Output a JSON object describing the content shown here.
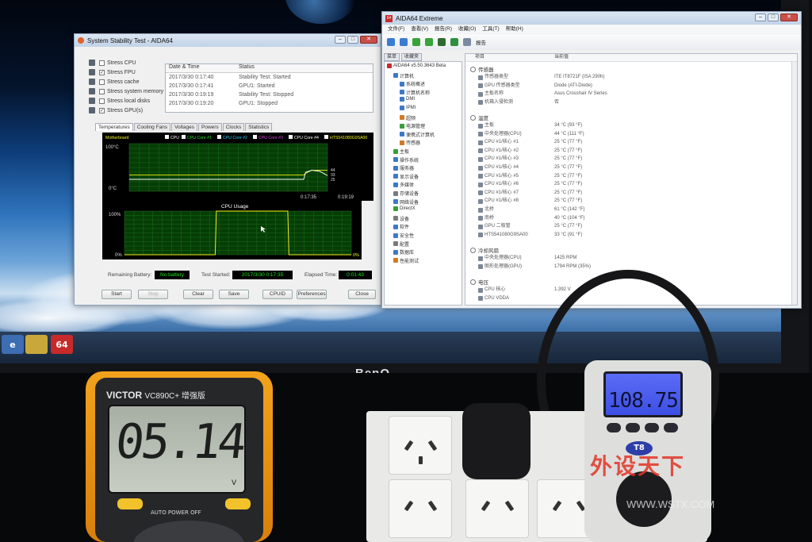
{
  "stability": {
    "title": "System Stability Test - AIDA64",
    "stress_items": [
      {
        "label": "Stress CPU",
        "checked": false
      },
      {
        "label": "Stress FPU",
        "checked": true
      },
      {
        "label": "Stress cache",
        "checked": false
      },
      {
        "label": "Stress system memory",
        "checked": false
      },
      {
        "label": "Stress local disks",
        "checked": false
      },
      {
        "label": "Stress GPU(s)",
        "checked": true
      }
    ],
    "log_headers": [
      "Date & Time",
      "Status"
    ],
    "log_rows": [
      {
        "time": "2017/3/30 0:17:40",
        "status": "Stability Test: Started"
      },
      {
        "time": "2017/3/30 0:17:41",
        "status": "GPU1: Started"
      },
      {
        "time": "2017/3/30 0:19:19",
        "status": "Stability Test: Stopped"
      },
      {
        "time": "2017/3/30 0:19:20",
        "status": "GPU1: Stopped"
      }
    ],
    "tabs": [
      "Temperatures",
      "Cooling Fans",
      "Voltages",
      "Powers",
      "Clocks",
      "Statistics"
    ],
    "legend": [
      {
        "label": "Motherboard",
        "color": "#f2f21a"
      },
      {
        "label": "CPU",
        "color": "#ffffff"
      },
      {
        "label": "CPU Core #1",
        "color": "#21e021"
      },
      {
        "label": "CPU Core #2",
        "color": "#2ad0ff"
      },
      {
        "label": "CPU Core #3",
        "color": "#e040e0"
      },
      {
        "label": "CPU Core #4",
        "color": "#ffffff"
      },
      {
        "label": "HTS541080G9SA00",
        "color": "#f2f21a"
      }
    ],
    "temp_axis": {
      "top": "100°C",
      "bottom": "0°C"
    },
    "temp_times": [
      "0:17:35",
      "0:19:19"
    ],
    "temp_values": [
      "44",
      "33",
      "25"
    ],
    "usage_title": "CPU Usage",
    "usage_axis": {
      "top": "100%",
      "bottom": "0%"
    },
    "usage_value": "0%",
    "remaining_label": "Remaining Battery:",
    "remaining_value": "No battery",
    "started_label": "Test Started:",
    "started_value": "2017/3/30 0:17:35",
    "elapsed_label": "Elapsed Time:",
    "elapsed_value": "0:01:43",
    "buttons": [
      "Start",
      "Stop",
      "Clear",
      "Save",
      "CPUID",
      "Preferences",
      "Close"
    ]
  },
  "aida": {
    "title": "AIDA64 Extreme",
    "menu": [
      "文件(F)",
      "查看(V)",
      "报告(R)",
      "收藏(O)",
      "工具(T)",
      "帮助(H)"
    ],
    "toolbar_report": "报告",
    "pane_tabs": [
      "菜单",
      "收藏夹"
    ],
    "tree": [
      {
        "label": "AIDA64 v5.50.3643 Beta",
        "indent": 0,
        "color": "#c62a2a"
      },
      {
        "label": "计算机",
        "indent": 1,
        "color": "#3d79c4"
      },
      {
        "label": "系统概述",
        "indent": 2,
        "color": "#3d79c4"
      },
      {
        "label": "计算机名称",
        "indent": 2,
        "color": "#3d79c4"
      },
      {
        "label": "DMI",
        "indent": 2,
        "color": "#3d79c4"
      },
      {
        "label": "IPMI",
        "indent": 2,
        "color": "#3d79c4"
      },
      {
        "label": "超频",
        "indent": 2,
        "color": "#d07a22"
      },
      {
        "label": "电源管理",
        "indent": 2,
        "color": "#3b9c3b"
      },
      {
        "label": "便携式计算机",
        "indent": 2,
        "color": "#3d79c4"
      },
      {
        "label": "传感器",
        "indent": 2,
        "color": "#d07a22"
      },
      {
        "label": "主板",
        "indent": 1,
        "color": "#3b9c3b"
      },
      {
        "label": "操作系统",
        "indent": 1,
        "color": "#3d79c4"
      },
      {
        "label": "服务器",
        "indent": 1,
        "color": "#3d79c4"
      },
      {
        "label": "显示设备",
        "indent": 1,
        "color": "#3d79c4"
      },
      {
        "label": "多媒体",
        "indent": 1,
        "color": "#3d79c4"
      },
      {
        "label": "存储设备",
        "indent": 1,
        "color": "#7a7a7a"
      },
      {
        "label": "网络设备",
        "indent": 1,
        "color": "#3d79c4"
      },
      {
        "label": "DirectX",
        "indent": 1,
        "color": "#3b9c3b"
      },
      {
        "label": "设备",
        "indent": 1,
        "color": "#7a7a7a"
      },
      {
        "label": "软件",
        "indent": 1,
        "color": "#3d79c4"
      },
      {
        "label": "安全性",
        "indent": 1,
        "color": "#3d79c4"
      },
      {
        "label": "配置",
        "indent": 1,
        "color": "#7a7a7a"
      },
      {
        "label": "数据库",
        "indent": 1,
        "color": "#3d79c4"
      },
      {
        "label": "性能测试",
        "indent": 1,
        "color": "#d07a22"
      }
    ],
    "list_headers": [
      "项目",
      "当前值"
    ],
    "group_sensor": "传感器",
    "sensor_rows": [
      {
        "name": "传感器类型",
        "value": "ITE IT8721F (ISA 290h)"
      },
      {
        "name": "GPU 传感器类型",
        "value": "Diode (ATI-Diode)"
      },
      {
        "name": "主板名称",
        "value": "Asus Crosshair IV Series"
      },
      {
        "name": "机箱入侵检测",
        "value": "否"
      }
    ],
    "group_temp": "温度",
    "temp_rows": [
      {
        "name": "主板",
        "value": "34 °C (93 °F)"
      },
      {
        "name": "中央处理器(CPU)",
        "value": "44 °C (111 °F)"
      },
      {
        "name": "CPU #1/核心 #1",
        "value": "25 °C (77 °F)"
      },
      {
        "name": "CPU #1/核心 #2",
        "value": "25 °C (77 °F)"
      },
      {
        "name": "CPU #1/核心 #3",
        "value": "25 °C (77 °F)"
      },
      {
        "name": "CPU #1/核心 #4",
        "value": "25 °C (77 °F)"
      },
      {
        "name": "CPU #1/核心 #5",
        "value": "25 °C (77 °F)"
      },
      {
        "name": "CPU #1/核心 #6",
        "value": "25 °C (77 °F)"
      },
      {
        "name": "CPU #1/核心 #7",
        "value": "25 °C (77 °F)"
      },
      {
        "name": "CPU #1/核心 #8",
        "value": "25 °C (77 °F)"
      },
      {
        "name": "北桥",
        "value": "61 °C (142 °F)"
      },
      {
        "name": "南桥",
        "value": "40 °C (104 °F)"
      },
      {
        "name": "GPU 二极管",
        "value": "25 °C (77 °F)"
      },
      {
        "name": "HTS541080G9SA00",
        "value": "33 °C (91 °F)"
      }
    ],
    "group_fan": "冷却风扇",
    "fan_rows": [
      {
        "name": "中央处理器(CPU)",
        "value": "1425 RPM"
      },
      {
        "name": "图形处理器(GPU)",
        "value": "1794 RPM (35%)"
      }
    ],
    "group_volt": "电压",
    "volt_rows": [
      {
        "name": "CPU 核心",
        "value": "1.392 V"
      },
      {
        "name": "CPU VDDA",
        "value": ""
      }
    ]
  },
  "taskbar": {
    "app_badge": "64"
  },
  "monitor_brand": "BenQ",
  "multimeter": {
    "brand": "VICTOR",
    "model": "VC890C+ 增强版",
    "reading": "05.14",
    "auto_off": "AUTO POWER OFF",
    "unit": "V"
  },
  "power_meter": {
    "reading": "108.75",
    "badge": "T8"
  },
  "watermark": {
    "text": "外设天下",
    "url": "WWW.WSTX.COM"
  },
  "chart_temp": {
    "lines": [
      {
        "color": "#f2f21a",
        "points": [
          [
            0,
            34
          ],
          [
            88,
            34
          ],
          [
            89,
            38
          ],
          [
            92,
            44
          ],
          [
            100,
            44
          ]
        ]
      },
      {
        "color": "#ffffff",
        "points": [
          [
            0,
            25
          ],
          [
            88,
            25
          ],
          [
            89,
            40
          ],
          [
            92,
            44
          ],
          [
            96,
            42
          ],
          [
            100,
            33
          ]
        ]
      }
    ]
  },
  "chart_usage": {
    "points": [
      [
        0,
        0
      ],
      [
        40,
        0
      ],
      [
        40.5,
        100
      ],
      [
        72,
        100
      ],
      [
        72.5,
        0
      ],
      [
        100,
        0
      ]
    ]
  }
}
